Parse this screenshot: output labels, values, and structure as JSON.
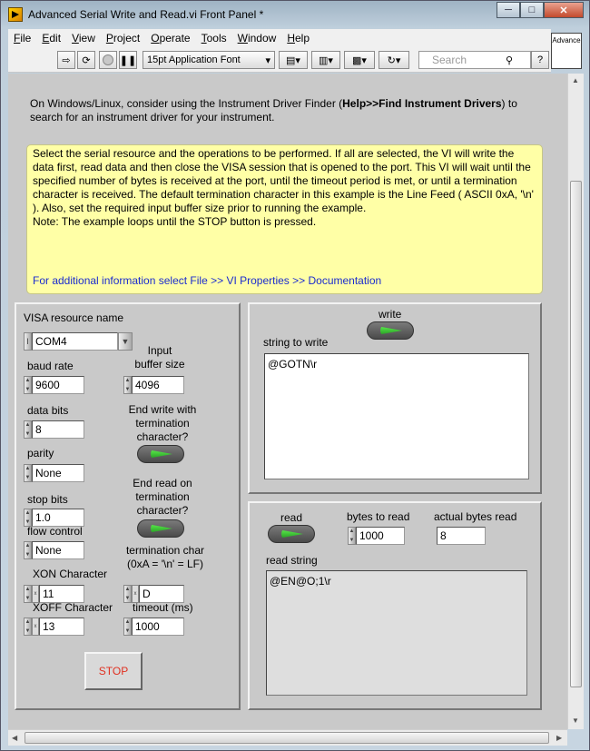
{
  "window": {
    "title": "Advanced Serial Write and Read.vi Front Panel *"
  },
  "menu": [
    {
      "label": "File",
      "u": "F",
      "rest": "ile"
    },
    {
      "label": "Edit",
      "u": "E",
      "rest": "dit"
    },
    {
      "label": "View",
      "u": "V",
      "rest": "iew"
    },
    {
      "label": "Project",
      "u": "P",
      "rest": "roject"
    },
    {
      "label": "Operate",
      "u": "O",
      "rest": "perate"
    },
    {
      "label": "Tools",
      "u": "T",
      "rest": "ools"
    },
    {
      "label": "Window",
      "u": "W",
      "rest": "indow"
    },
    {
      "label": "Help",
      "u": "H",
      "rest": "elp"
    }
  ],
  "toolbar": {
    "font": "15pt Application Font",
    "search_placeholder": "Search"
  },
  "vi_icon_text": "Advance",
  "intro": {
    "pre": "On Windows/Linux, consider using the Instrument Driver Finder (",
    "bold": "Help>>Find Instrument Drivers",
    "post": ") to search for an instrument driver for your instrument."
  },
  "note": {
    "p1": "Select the serial resource and the operations to be performed.  If all are selected, the VI will write the data first, read data and then close the VISA session that is opened to the port.  This VI will wait until the specified number of bytes is received at the port, until the timeout period is met, or until a termination character is received.  The default termination character in this example is the Line Feed ( ASCII 0xA, '\\n' ).  Also, set the required input buffer size prior to running the example.",
    "p2": "Note: The example loops until the STOP button is pressed.",
    "link": "For additional information select File >> VI Properties >> Documentation"
  },
  "left": {
    "visa_label": "VISA resource name",
    "visa_value": "COM4",
    "baud_label": "baud rate",
    "baud_value": "9600",
    "buffer_label": "Input\nbuffer size",
    "buffer_value": "4096",
    "databits_label": "data bits",
    "databits_value": "8",
    "endwrite_label": "End write with\ntermination\ncharacter?",
    "parity_label": "parity",
    "parity_value": "None",
    "endread_label": "End read on\ntermination\ncharacter?",
    "stopbits_label": "stop bits",
    "stopbits_value": "1.0",
    "flow_label": "flow control",
    "flow_value": "None",
    "termchar_label": "termination char\n(0xA = '\\n' = LF)",
    "termchar_value": "D",
    "xon_label": "XON Character",
    "xon_value": "11",
    "xoff_label": "XOFF Character",
    "xoff_value": "13",
    "timeout_label": "timeout (ms)",
    "timeout_value": "1000",
    "radix": "x",
    "stop_label": "STOP"
  },
  "write": {
    "label": "write",
    "string_label": "string to write",
    "string_value": "@GOTN\\r"
  },
  "read": {
    "label": "read",
    "bytes_label": "bytes to read",
    "bytes_value": "1000",
    "actual_label": "actual bytes read",
    "actual_value": "8",
    "string_label": "read string",
    "string_value": "@EN@O;1\\r"
  }
}
